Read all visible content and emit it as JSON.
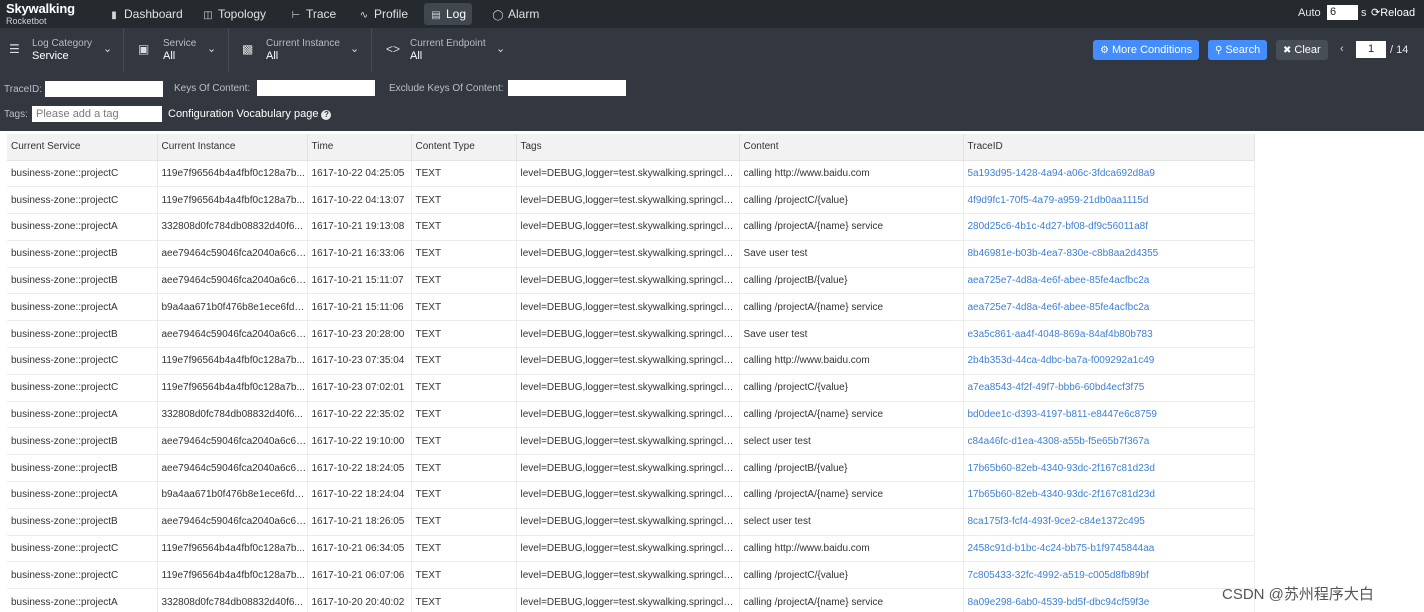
{
  "brand": {
    "title": "Skywalking",
    "subtitle": "Rocketbot"
  },
  "nav": [
    {
      "label": "Dashboard",
      "icon": "bar-chart-icon"
    },
    {
      "label": "Topology",
      "icon": "topology-icon"
    },
    {
      "label": "Trace",
      "icon": "trace-icon"
    },
    {
      "label": "Profile",
      "icon": "profile-icon"
    },
    {
      "label": "Log",
      "icon": "log-icon"
    },
    {
      "label": "Alarm",
      "icon": "alarm-icon"
    }
  ],
  "auto": {
    "label": "Auto",
    "value": "6",
    "unit": "s",
    "reload_label": "Reload"
  },
  "selectors": [
    {
      "label": "Log Category",
      "value": "Service",
      "icon": "filter-icon"
    },
    {
      "label": "Service",
      "value": "All",
      "icon": "service-icon"
    },
    {
      "label": "Current Instance",
      "value": "All",
      "icon": "instance-icon"
    },
    {
      "label": "Current Endpoint",
      "value": "All",
      "icon": "endpoint-icon"
    }
  ],
  "buttons": {
    "more_conditions": "More Conditions",
    "search": "Search",
    "clear": "Clear"
  },
  "pager": {
    "current": "1",
    "total_label": "/ 14"
  },
  "filters": {
    "trace_id_label": "TraceID:",
    "keys_label": "Keys Of Content:",
    "exclude_label": "Exclude Keys Of Content:",
    "tags_label": "Tags:",
    "tags_placeholder": "Please add a tag",
    "config_link": "Configuration Vocabulary page"
  },
  "table": {
    "columns": [
      "Current Service",
      "Current Instance",
      "Time",
      "Content Type",
      "Tags",
      "Content",
      "TraceID"
    ],
    "rows": [
      [
        "business-zone::projectC",
        "119e7f96564b4a4fbf0c128a7b...",
        "1617-10-22 04:25:05",
        "TEXT",
        "level=DEBUG,logger=test.skywalking.springclou...",
        "calling http://www.baidu.com",
        "5a193d95-1428-4a94-a06c-3fdca692d8a9"
      ],
      [
        "business-zone::projectC",
        "119e7f96564b4a4fbf0c128a7b...",
        "1617-10-22 04:13:07",
        "TEXT",
        "level=DEBUG,logger=test.skywalking.springclou...",
        "calling /projectC/{value}",
        "4f9d9fc1-70f5-4a79-a959-21db0aa1115d"
      ],
      [
        "business-zone::projectA",
        "332808d0fc784db08832d40f6...",
        "1617-10-21 19:13:08",
        "TEXT",
        "level=DEBUG,logger=test.skywalking.springclou...",
        "calling /projectA/{name} service",
        "280d25c6-4b1c-4d27-bf08-df9c56011a8f"
      ],
      [
        "business-zone::projectB",
        "aee79464c59046fca2040a6c68...",
        "1617-10-21 16:33:06",
        "TEXT",
        "level=DEBUG,logger=test.skywalking.springclou...",
        "Save user test",
        "8b46981e-b03b-4ea7-830e-c8b8aa2d4355"
      ],
      [
        "business-zone::projectB",
        "aee79464c59046fca2040a6c68...",
        "1617-10-21 15:11:07",
        "TEXT",
        "level=DEBUG,logger=test.skywalking.springclou...",
        "calling /projectB/{value}",
        "aea725e7-4d8a-4e6f-abee-85fe4acfbc2a"
      ],
      [
        "business-zone::projectA",
        "b9a4aa671b0f476b8e1ece6fd8...",
        "1617-10-21 15:11:06",
        "TEXT",
        "level=DEBUG,logger=test.skywalking.springclou...",
        "calling /projectA/{name} service",
        "aea725e7-4d8a-4e6f-abee-85fe4acfbc2a"
      ],
      [
        "business-zone::projectB",
        "aee79464c59046fca2040a6c68...",
        "1617-10-23 20:28:00",
        "TEXT",
        "level=DEBUG,logger=test.skywalking.springclou...",
        "Save user test",
        "e3a5c861-aa4f-4048-869a-84af4b80b783"
      ],
      [
        "business-zone::projectC",
        "119e7f96564b4a4fbf0c128a7b...",
        "1617-10-23 07:35:04",
        "TEXT",
        "level=DEBUG,logger=test.skywalking.springclou...",
        "calling http://www.baidu.com",
        "2b4b353d-44ca-4dbc-ba7a-f009292a1c49"
      ],
      [
        "business-zone::projectC",
        "119e7f96564b4a4fbf0c128a7b...",
        "1617-10-23 07:02:01",
        "TEXT",
        "level=DEBUG,logger=test.skywalking.springclou...",
        "calling /projectC/{value}",
        "a7ea8543-4f2f-49f7-bbb6-60bd4ecf3f75"
      ],
      [
        "business-zone::projectA",
        "332808d0fc784db08832d40f6...",
        "1617-10-22 22:35:02",
        "TEXT",
        "level=DEBUG,logger=test.skywalking.springclou...",
        "calling /projectA/{name} service",
        "bd0dee1c-d393-4197-b811-e8447e6c8759"
      ],
      [
        "business-zone::projectB",
        "aee79464c59046fca2040a6c68...",
        "1617-10-22 19:10:00",
        "TEXT",
        "level=DEBUG,logger=test.skywalking.springclou...",
        "select user test",
        "c84a46fc-d1ea-4308-a55b-f5e65b7f367a"
      ],
      [
        "business-zone::projectB",
        "aee79464c59046fca2040a6c68...",
        "1617-10-22 18:24:05",
        "TEXT",
        "level=DEBUG,logger=test.skywalking.springclou...",
        "calling /projectB/{value}",
        "17b65b60-82eb-4340-93dc-2f167c81d23d"
      ],
      [
        "business-zone::projectA",
        "b9a4aa671b0f476b8e1ece6fd8...",
        "1617-10-22 18:24:04",
        "TEXT",
        "level=DEBUG,logger=test.skywalking.springclou...",
        "calling /projectA/{name} service",
        "17b65b60-82eb-4340-93dc-2f167c81d23d"
      ],
      [
        "business-zone::projectB",
        "aee79464c59046fca2040a6c68...",
        "1617-10-21 18:26:05",
        "TEXT",
        "level=DEBUG,logger=test.skywalking.springclou...",
        "select user test",
        "8ca175f3-fcf4-493f-9ce2-c84e1372c495"
      ],
      [
        "business-zone::projectC",
        "119e7f96564b4a4fbf0c128a7b...",
        "1617-10-21 06:34:05",
        "TEXT",
        "level=DEBUG,logger=test.skywalking.springclou...",
        "calling http://www.baidu.com",
        "2458c91d-b1bc-4c24-bb75-b1f9745844aa"
      ],
      [
        "business-zone::projectC",
        "119e7f96564b4a4fbf0c128a7b...",
        "1617-10-21 06:07:06",
        "TEXT",
        "level=DEBUG,logger=test.skywalking.springclou...",
        "calling /projectC/{value}",
        "7c805433-32fc-4992-a519-c005d8fb89bf"
      ],
      [
        "business-zone::projectA",
        "332808d0fc784db08832d40f6...",
        "1617-10-20 20:40:02",
        "TEXT",
        "level=DEBUG,logger=test.skywalking.springclou...",
        "calling /projectA/{name} service",
        "8a09e298-6ab0-4539-bd5f-dbc94cf59f3e"
      ]
    ]
  },
  "watermark": "CSDN @苏州程序大白",
  "colors": {
    "nav_bg": "#252a2f",
    "toolbar_bg": "#333840",
    "primary": "#448dfe",
    "link": "#3d7fd6"
  }
}
